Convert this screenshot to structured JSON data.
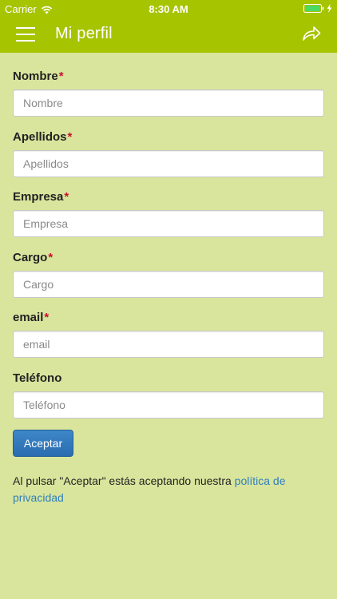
{
  "status_bar": {
    "carrier": "Carrier",
    "time": "8:30 AM"
  },
  "nav": {
    "title": "Mi perfil",
    "menu_icon": "hamburger-menu-icon",
    "share_icon": "share-forward-icon"
  },
  "form": {
    "required_mark": "*",
    "fields": [
      {
        "label": "Nombre",
        "placeholder": "Nombre",
        "value": "",
        "required": true
      },
      {
        "label": "Apellidos",
        "placeholder": "Apellidos",
        "value": "",
        "required": true
      },
      {
        "label": "Empresa",
        "placeholder": "Empresa",
        "value": "",
        "required": true
      },
      {
        "label": "Cargo",
        "placeholder": "Cargo",
        "value": "",
        "required": true
      },
      {
        "label": "email",
        "placeholder": "email",
        "value": "",
        "required": true
      },
      {
        "label": "Teléfono",
        "placeholder": "Teléfono",
        "value": "",
        "required": false
      }
    ],
    "submit_label": "Aceptar"
  },
  "legal": {
    "text": "Al pulsar \"Aceptar\" estás aceptando nuestra ",
    "link_text": "política de privacidad"
  },
  "colors": {
    "accent": "#a7c400",
    "background": "#d9e59c",
    "button": "#2f77bb",
    "link": "#2f7fbf",
    "required": "#c8102e"
  }
}
